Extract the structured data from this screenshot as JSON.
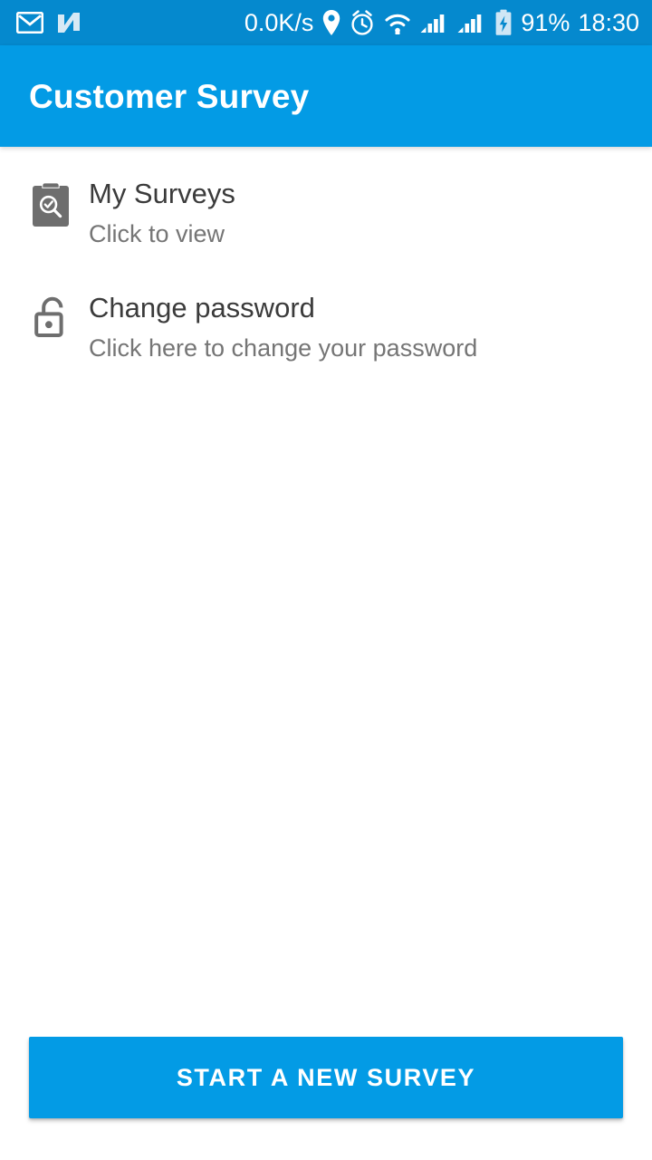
{
  "status_bar": {
    "background_color": "#0589CE",
    "left_icons": [
      {
        "name": "gmail-icon",
        "label": "Gmail"
      },
      {
        "name": "nexus-n-icon",
        "label": "N"
      }
    ],
    "network_speed": "0.0K/s",
    "right_icons": [
      {
        "name": "location-pin-icon",
        "label": "Location"
      },
      {
        "name": "alarm-clock-icon",
        "label": "Alarm"
      },
      {
        "name": "wifi-icon",
        "label": "Wi-Fi"
      },
      {
        "name": "signal-bars-sim1-icon",
        "label": "Signal SIM 1"
      },
      {
        "name": "signal-bars-sim2-icon",
        "label": "Signal SIM 2"
      },
      {
        "name": "battery-charging-icon",
        "label": "Battery charging"
      }
    ],
    "battery_percent": "91%",
    "clock": "18:30"
  },
  "app_bar": {
    "title": "Customer Survey",
    "background_color": "#039BE5",
    "text_color": "#FFFFFF"
  },
  "main": {
    "background_color": "#FFFFFF",
    "items": [
      {
        "icon": "clipboard-search-icon",
        "title": "My Surveys",
        "subtitle": "Click to view"
      },
      {
        "icon": "unlocked-padlock-icon",
        "title": "Change password",
        "subtitle": "Click here to change your password"
      }
    ],
    "title_color": "#3B3B3B",
    "subtitle_color": "#757575"
  },
  "bottom_action": {
    "label": "START A NEW SURVEY",
    "background_color": "#039BE5",
    "text_color": "#FFFFFF"
  }
}
